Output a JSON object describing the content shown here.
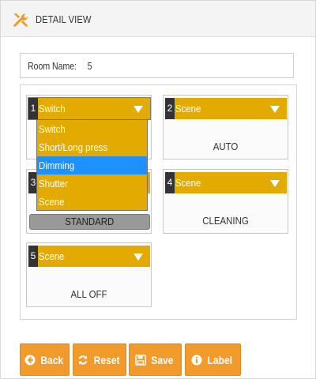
{
  "header": {
    "title": "DETAIL VIEW",
    "icon": "wrench-icon"
  },
  "room": {
    "label": "Room Name:",
    "value": "5"
  },
  "tiles": [
    {
      "number": "1",
      "selected": "Switch",
      "mode": "STANDARD"
    },
    {
      "number": "2",
      "selected": "Scene",
      "mode": "AUTO"
    },
    {
      "number": "3",
      "selected": "",
      "mode": ""
    },
    {
      "number": "4",
      "selected": "Scene",
      "mode": "CLEANING"
    },
    {
      "number": "5",
      "selected": "Scene",
      "mode": "ALL OFF"
    }
  ],
  "dropdown": {
    "options": [
      "Switch",
      "Short/Long press",
      "Dimming",
      "Shutter",
      "Scene"
    ],
    "highlighted": "Dimming"
  },
  "buttons": {
    "back": "Back",
    "reset": "Reset",
    "save": "Save",
    "label": "Label"
  },
  "colors": {
    "accent": "#e3ab00",
    "button": "#f29b2b",
    "highlight": "#1e90ff",
    "badge": "#999999"
  }
}
